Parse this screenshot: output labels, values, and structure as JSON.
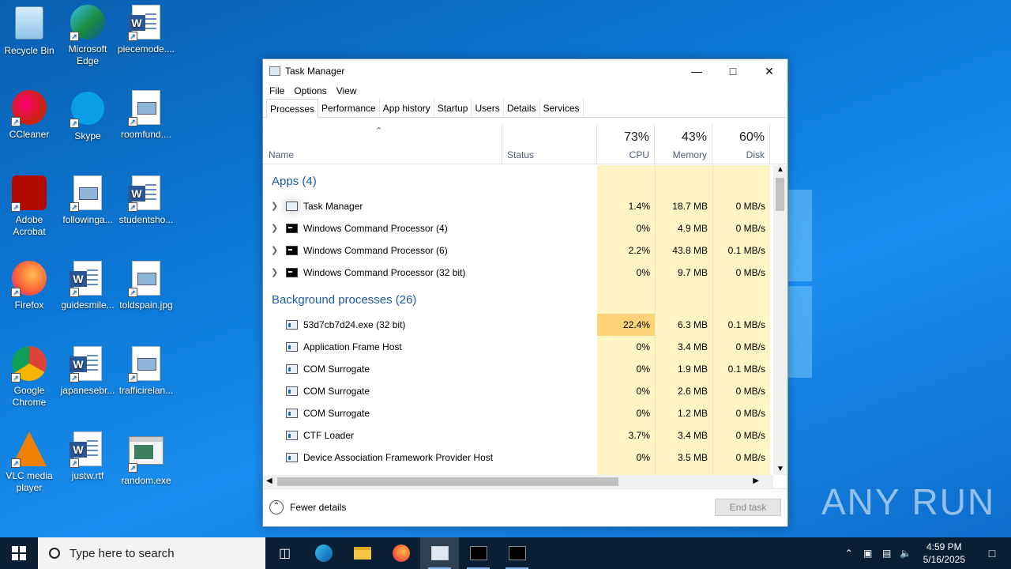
{
  "desktop": {
    "icons": [
      {
        "label": "Recycle Bin"
      },
      {
        "label": "Microsoft Edge"
      },
      {
        "label": "piecemode...."
      },
      {
        "label": "CCleaner"
      },
      {
        "label": "Skype"
      },
      {
        "label": "roomfund...."
      },
      {
        "label": "Adobe Acrobat"
      },
      {
        "label": "followinga..."
      },
      {
        "label": "studentsho..."
      },
      {
        "label": "Firefox"
      },
      {
        "label": "guidesmile..."
      },
      {
        "label": "toldspain.jpg"
      },
      {
        "label": "Google Chrome"
      },
      {
        "label": "japanesebr..."
      },
      {
        "label": "trafficirelan..."
      },
      {
        "label": "VLC media player"
      },
      {
        "label": "justw.rtf"
      },
      {
        "label": "random.exe"
      }
    ],
    "watermark": "ANY RUN"
  },
  "window": {
    "title": "Task Manager",
    "menu": [
      "File",
      "Options",
      "View"
    ],
    "tabs": [
      "Processes",
      "Performance",
      "App history",
      "Startup",
      "Users",
      "Details",
      "Services"
    ],
    "columns": {
      "name": "Name",
      "status": "Status",
      "cpu_pct": "73%",
      "cpu": "CPU",
      "mem_pct": "43%",
      "mem": "Memory",
      "disk_pct": "60%",
      "disk": "Disk"
    },
    "groups": {
      "apps": "Apps (4)",
      "background": "Background processes (26)"
    },
    "apps": [
      {
        "name": "Task Manager",
        "cpu": "1.4%",
        "mem": "18.7 MB",
        "disk": "0 MB/s"
      },
      {
        "name": "Windows Command Processor (4)",
        "cpu": "0%",
        "mem": "4.9 MB",
        "disk": "0 MB/s"
      },
      {
        "name": "Windows Command Processor (6)",
        "cpu": "2.2%",
        "mem": "43.8 MB",
        "disk": "0.1 MB/s"
      },
      {
        "name": "Windows Command Processor (32 bit)",
        "cpu": "0%",
        "mem": "9.7 MB",
        "disk": "0 MB/s"
      }
    ],
    "background": [
      {
        "name": "53d7cb7d24.exe (32 bit)",
        "cpu": "22.4%",
        "mem": "6.3 MB",
        "disk": "0.1 MB/s"
      },
      {
        "name": "Application Frame Host",
        "cpu": "0%",
        "mem": "3.4 MB",
        "disk": "0 MB/s"
      },
      {
        "name": "COM Surrogate",
        "cpu": "0%",
        "mem": "1.9 MB",
        "disk": "0.1 MB/s"
      },
      {
        "name": "COM Surrogate",
        "cpu": "0%",
        "mem": "2.6 MB",
        "disk": "0 MB/s"
      },
      {
        "name": "COM Surrogate",
        "cpu": "0%",
        "mem": "1.2 MB",
        "disk": "0 MB/s"
      },
      {
        "name": "CTF Loader",
        "cpu": "3.7%",
        "mem": "3.4 MB",
        "disk": "0 MB/s"
      },
      {
        "name": "Device Association Framework Provider Host",
        "cpu": "0%",
        "mem": "3.5 MB",
        "disk": "0 MB/s"
      }
    ],
    "footer": {
      "fewer_details": "Fewer details",
      "end_task": "End task"
    }
  },
  "taskbar": {
    "search_placeholder": "Type here to search",
    "time": "4:59 PM",
    "date": "5/16/2025"
  },
  "colors": {
    "cpu_shade": "#fff4c4",
    "cpu_hot": "#ffd278",
    "mem_shade": "#fff4c4",
    "group_text": "#1e5aa8"
  }
}
